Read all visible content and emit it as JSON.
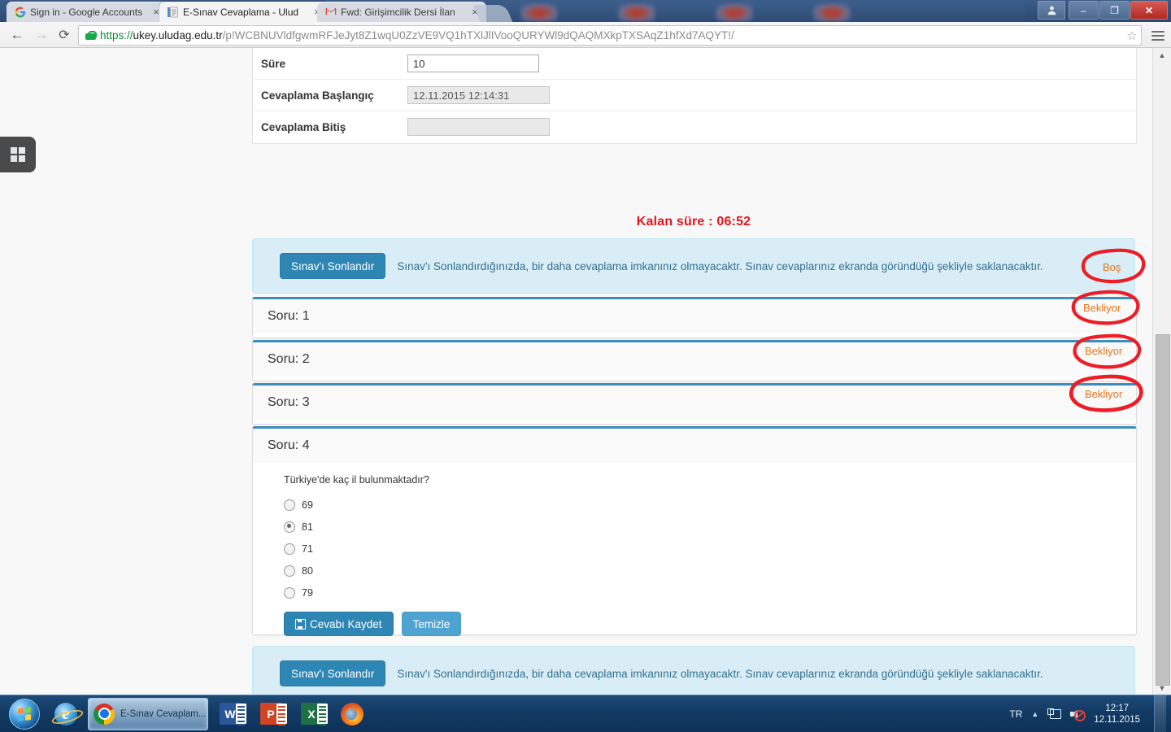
{
  "browser": {
    "tabs": [
      {
        "title": "Sign in - Google Accounts",
        "favicon": "google-icon",
        "close": "×",
        "active": false
      },
      {
        "title": "E-Sınav Cevaplama - Ulud",
        "favicon": "document-icon",
        "close": "×",
        "active": true
      },
      {
        "title": "Fwd: Girişimcilik Dersi İlan",
        "favicon": "gmail-icon",
        "close": "×",
        "active": false
      }
    ],
    "nav": {
      "back": "←",
      "forward": "→",
      "reload": "⟳"
    },
    "url": {
      "scheme": "https://",
      "host": "ukey.uludag.edu.tr",
      "path": "/p!WCBNUVldfgwmRFJeJyt8Z1wqU0ZzVE9VQ1hTXlJlIVooQURYWl9dQAQMXkpTXSAqZ1hfXd7AQYT!/"
    },
    "url_full": "https://ukey.uludag.edu.tr/p!WCBNUVldfgwmRFJeJyt8Z1wqU0ZzVE9VQ1hTXlJlIVooQURYWl9dQAQMXkpTXSAqZ1hfXd7AQYT!/",
    "star": "☆",
    "window_controls": {
      "user": "👤",
      "minimize": "–",
      "maximize": "❐",
      "close": "✕"
    }
  },
  "widget": {
    "icon": "windows-grid-icon"
  },
  "form": {
    "rows": [
      {
        "label": "Süre",
        "value": "10",
        "disabled": false
      },
      {
        "label": "Cevaplama Başlangıç",
        "value": "12.11.2015 12:14:31",
        "disabled": true
      },
      {
        "label": "Cevaplama Bitiş",
        "value": "",
        "disabled": true
      }
    ]
  },
  "timer": {
    "text": "Kalan süre : 06:52",
    "color": "#e8141c"
  },
  "alert": {
    "button_label": "Sınav'ı Sonlandır",
    "message": "Sınav'ı Sonlandırdığınızda, bir daha cevaplama imkanınız olmayacaktr. Sınav cevaplarınız ekranda göründüğü şekliyle saklanacaktır."
  },
  "questions": [
    {
      "title": "Soru: 1",
      "status": "Boş"
    },
    {
      "title": "Soru: 2",
      "status": "Bekliyor"
    },
    {
      "title": "Soru: 3",
      "status": "Bekliyor"
    },
    {
      "title": "Soru: 4",
      "status": "Bekliyor"
    }
  ],
  "question4": {
    "title": "Soru: 4",
    "text": "Türkiye'de kaç il bulunmaktadır?",
    "options": [
      {
        "label": "69",
        "selected": false
      },
      {
        "label": "81",
        "selected": true
      },
      {
        "label": "71",
        "selected": false
      },
      {
        "label": "80",
        "selected": false
      },
      {
        "label": "79",
        "selected": false
      }
    ],
    "save_label": "Cevabı Kaydet",
    "clear_label": "Temizle",
    "save_icon": "floppy-disk-icon"
  },
  "colors": {
    "accent_blue": "#3c8dbc",
    "button_blue": "#2e86b4",
    "button_light_blue": "#4fa3d1",
    "alert_bg": "#d9edf7",
    "alert_border": "#bce8f1",
    "alert_text": "#31708f",
    "timer_red": "#e8141c",
    "status_orange": "#e8761b",
    "annotation_red": "#ee1c24"
  },
  "scrollbar": {
    "up_arrow": "▲",
    "down_arrow": "▼"
  },
  "taskbar": {
    "start": "windows-start-orb",
    "items": [
      {
        "name": "internet-explorer",
        "label": "",
        "active": false
      },
      {
        "name": "google-chrome",
        "label": "E-Sınav Cevaplam...",
        "active": true
      },
      {
        "name": "microsoft-word",
        "label": "",
        "active": false
      },
      {
        "name": "microsoft-powerpoint",
        "label": "",
        "active": false
      },
      {
        "name": "microsoft-excel",
        "label": "",
        "active": false
      },
      {
        "name": "mozilla-firefox",
        "label": "",
        "active": false
      }
    ],
    "tray": {
      "language": "TR",
      "up_arrow": "▲",
      "network_icon": "network-icon",
      "volume_icon": "volume-muted-icon",
      "time": "12:17",
      "date": "12.11.2015"
    }
  }
}
